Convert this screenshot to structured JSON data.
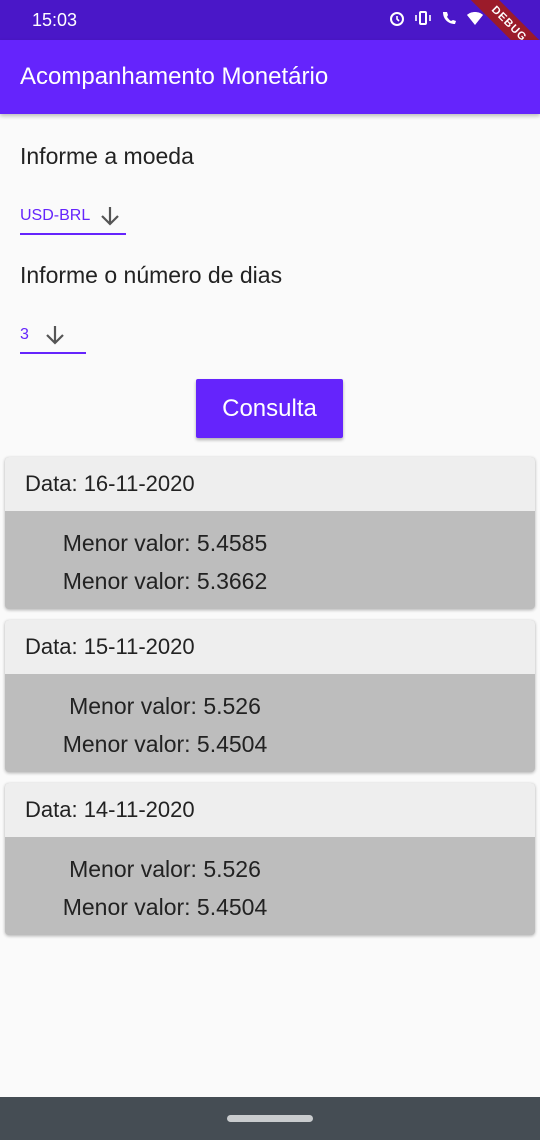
{
  "status": {
    "time": "15:03",
    "icons": [
      "alarm-icon",
      "vibrate-icon",
      "volte-call-icon",
      "wifi-icon",
      "battery-icon"
    ],
    "debug_label": "DEBUG"
  },
  "app_bar": {
    "title": "Acompanhamento Monetário"
  },
  "currency": {
    "label": "Informe a moeda",
    "selected": "USD-BRL"
  },
  "days": {
    "label": "Informe o número de dias",
    "selected": "3"
  },
  "button": {
    "label": "Consulta"
  },
  "results": [
    {
      "date": "Data: 16-11-2020",
      "line1": "Menor valor: 5.4585",
      "line2": "Menor valor: 5.3662"
    },
    {
      "date": "Data: 15-11-2020",
      "line1": "Menor valor: 5.526",
      "line2": "Menor valor: 5.4504"
    },
    {
      "date": "Data: 14-11-2020",
      "line1": "Menor valor: 5.526",
      "line2": "Menor valor: 5.4504"
    }
  ],
  "colors": {
    "primary": "#6524fc",
    "status_bar": "#4a17c8",
    "card_header": "#eeeeee",
    "card_body": "#bdbdbd",
    "nav_bar": "#454d54"
  }
}
